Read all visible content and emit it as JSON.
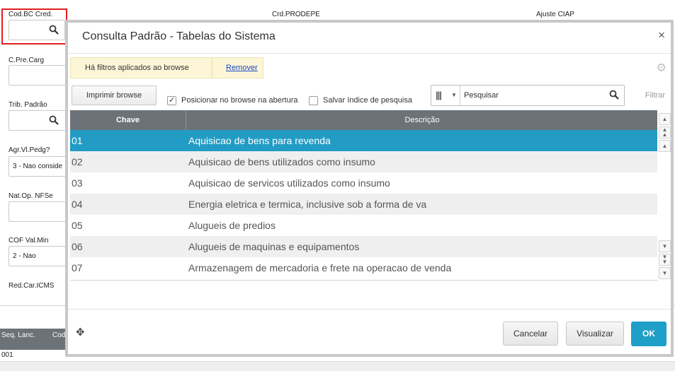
{
  "form": {
    "fields": [
      {
        "label": "Cod.BC Cred.",
        "value": ""
      },
      {
        "label": "C.Pre.Carg",
        "value": ""
      },
      {
        "label": "Trib. Padrão",
        "value": ""
      },
      {
        "label": "Agr.Vl.Pedg?",
        "value": "3 - Nao conside"
      },
      {
        "label": "Nat.Op. NFSe",
        "value": ""
      },
      {
        "label": "COF Val.Min",
        "value": "2 - Nao"
      },
      {
        "label": "Red.Car.ICMS",
        "value": ""
      }
    ],
    "top_labels": [
      "Crd.PRODEPE",
      "Ajuste CIAP"
    ],
    "grid_headers": [
      "Seq. Lanc.",
      "Cod"
    ],
    "grid_first_value": "001"
  },
  "modal": {
    "title": "Consulta Padrão - Tabelas do Sistema",
    "close_icon": "×",
    "filter_message": "Há filtros aplicados ao browse",
    "filter_remove": "Remover",
    "print_button": "Imprimir browse",
    "option_position": "Posicionar no browse na abertura",
    "option_position_checked": true,
    "option_save_index": "Salvar índice de pesquisa",
    "option_save_index_checked": false,
    "search_placeholder": "Pesquisar",
    "filter_label": "Filtrar",
    "columns": [
      "Chave",
      "Descrição"
    ],
    "rows": [
      {
        "key": "01",
        "desc": "Aquisicao de bens para revenda"
      },
      {
        "key": "02",
        "desc": "Aquisicao de bens utilizados como insumo"
      },
      {
        "key": "03",
        "desc": "Aquisicao de servicos utilizados como insumo"
      },
      {
        "key": "04",
        "desc": "Energia eletrica e termica, inclusive sob a forma de va"
      },
      {
        "key": "05",
        "desc": "Alugueis de predios"
      },
      {
        "key": "06",
        "desc": "Alugueis de maquinas e equipamentos"
      },
      {
        "key": "07",
        "desc": "Armazenagem de mercadoria e frete na operacao de venda"
      }
    ],
    "selected_row": "01",
    "buttons": {
      "cancel": "Cancelar",
      "view": "Visualizar",
      "ok": "OK"
    }
  },
  "colors": {
    "accent": "#229cc4",
    "header": "#6b7278",
    "highlight": "#e02020",
    "filter_bg": "#fcf6d7"
  }
}
